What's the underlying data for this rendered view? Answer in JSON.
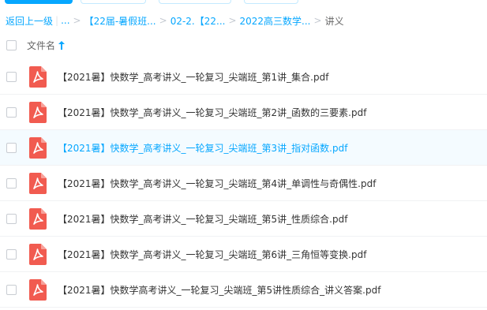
{
  "breadcrumb": {
    "back": "返回上一级",
    "ellipsis": "...",
    "items": [
      "【22届-暑假班...",
      "02-2.【22...",
      "2022高三数学..."
    ],
    "current": "讲义"
  },
  "header": {
    "name_label": "文件名"
  },
  "files": [
    "【2021暑】快数学_高考讲义_一轮复习_尖端班_第1讲_集合.pdf",
    "【2021暑】快数学_高考讲义_一轮复习_尖端班_第2讲_函数的三要素.pdf",
    "【2021暑】快数学_高考讲义_一轮复习_尖端班_第3讲_指对函数.pdf",
    "【2021暑】快数学_高考讲义_一轮复习_尖端班_第4讲_单调性与奇偶性.pdf",
    "【2021暑】快数学_高考讲义_一轮复习_尖端班_第5讲_性质综合.pdf",
    "【2021暑】快数学_高考讲义_一轮复习_尖端班_第6讲_三角恒等变换.pdf",
    "【2021暑】快数学高考讲义_一轮复习_尖端班_第5讲性质综合_讲义答案.pdf"
  ],
  "hover_row_index": 2,
  "icons": {
    "file_type": "pdf-file-icon",
    "sort": "sort-ascending-icon"
  },
  "colors": {
    "accent": "#06a7ff",
    "pdf_red": "#f15b50",
    "hover_row": "#f4fbff"
  }
}
